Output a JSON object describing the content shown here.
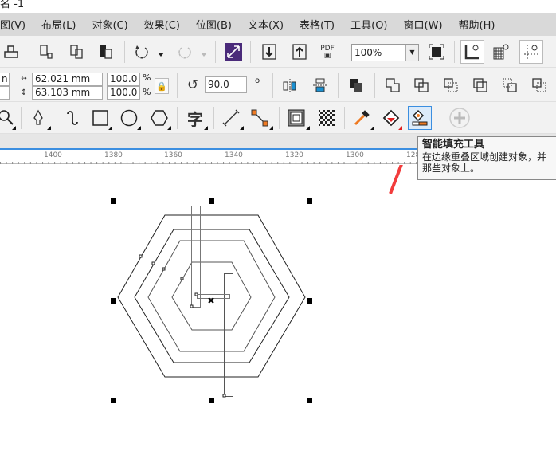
{
  "window": {
    "title": "名 -1"
  },
  "menu": [
    "图(V)",
    "布局(L)",
    "对象(C)",
    "效果(C)",
    "位图(B)",
    "文本(X)",
    "表格(T)",
    "工具(O)",
    "窗口(W)",
    "帮助(H)"
  ],
  "toolbar": {
    "zoom_value": "100%",
    "pdf_label": "PDF"
  },
  "properties": {
    "width": "62.021 mm",
    "height": "63.103 mm",
    "scale_x": "100.0",
    "scale_y": "100.0",
    "percent": "%",
    "rotation": "90.0",
    "degree": "o",
    "x_partial": "n"
  },
  "tools": {
    "text_icon": "字"
  },
  "ruler": {
    "ticks": [
      "1400",
      "1380",
      "1360",
      "1340",
      "1320",
      "1300",
      "128"
    ]
  },
  "tooltip": {
    "title": "智能填充工具",
    "line1": "在边缘重叠区域创建对象，并",
    "line2": "那些对象上。"
  },
  "colors": {
    "accent": "#3b8ee0",
    "arrow": "#f23c3c"
  }
}
